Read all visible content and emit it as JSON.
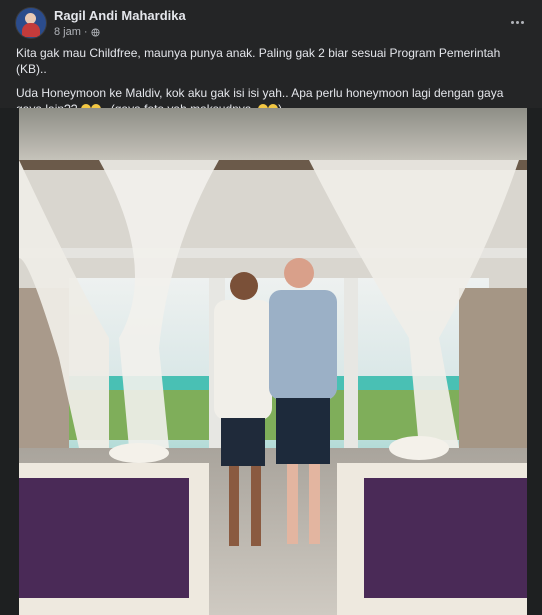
{
  "post": {
    "author": "Ragil Andi Mahardika",
    "time": "8 jam",
    "privacy_icon": "globe-icon",
    "more_icon": "more-options-icon",
    "paragraphs": [
      "Kita gak mau Childfree, maunya punya anak. Paling gak 2 biar sesuai Program Pemerintah (KB)..",
      "Uda Honeymoon ke Maldiv, kok aku gak isi isi yah.. Apa perlu honeymoon lagi dengan gaya gaya lain?? "
    ],
    "p2_mid": ".. (gaya foto yah maksudnya..",
    "p2_end": ")..."
  },
  "colors": {
    "background": "#242526",
    "text": "#e4e6eb",
    "secondary_text": "#b0b3b8",
    "bedspread": "#4a2a57"
  }
}
